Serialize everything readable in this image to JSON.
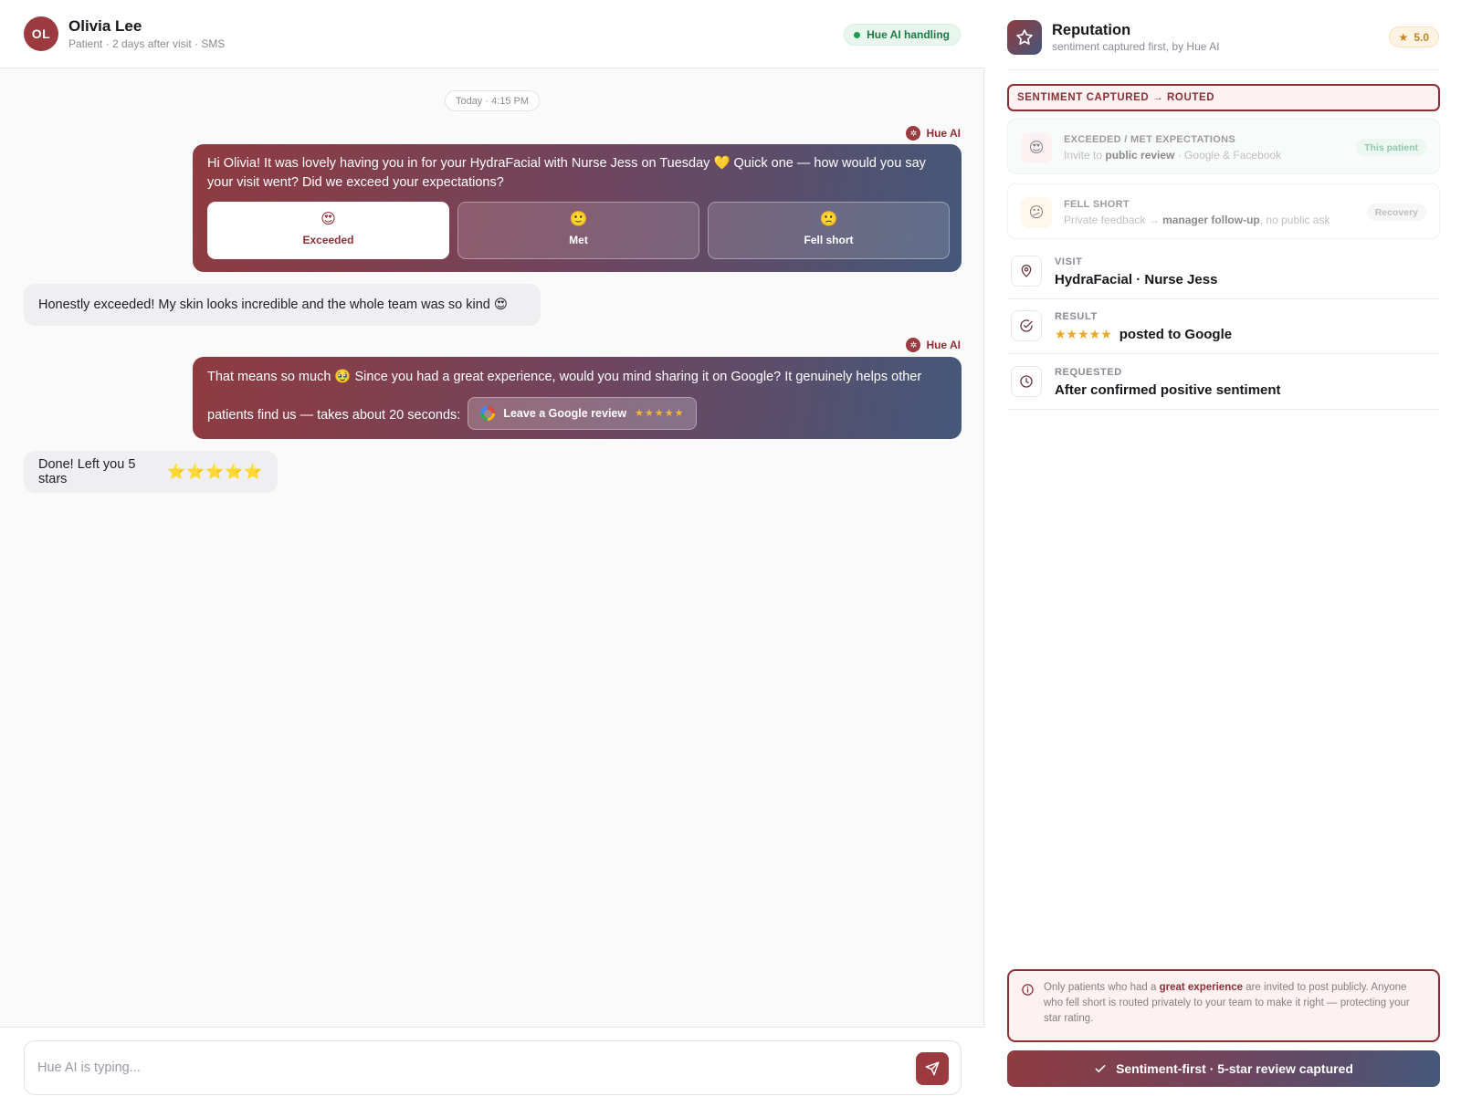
{
  "header": {
    "avatar_initials": "OL",
    "name": "Olivia Lee",
    "subtitle": "Patient · 2 days after visit · SMS",
    "status_pill": "Hue AI handling"
  },
  "chat": {
    "timestamp": "Today · 4:15 PM",
    "ai_sender": "Hue AI",
    "messages": [
      {
        "from": "ai",
        "text": "Hi Olivia! It was lovely having you in for your HydraFacial with Nurse Jess on Tuesday 💛 Quick one — how would you say your visit went? Did we exceed your expectations?",
        "choices": [
          {
            "emoji": "😍",
            "label": "Exceeded",
            "selected": true
          },
          {
            "emoji": "🙂",
            "label": "Met",
            "selected": false
          },
          {
            "emoji": "🙁",
            "label": "Fell short",
            "selected": false
          }
        ]
      },
      {
        "from": "patient",
        "text": "Honestly exceeded! My skin looks incredible and the whole team was so kind",
        "emoji": "😍"
      },
      {
        "from": "ai",
        "text": "That means so much 🥹 Since you had a great experience, would you mind sharing it on Google? It genuinely helps other patients find us — takes about 20 seconds:",
        "button_label": "Leave a Google review",
        "button_stars": "★★★★★"
      },
      {
        "from": "patient",
        "text": "Done! Left you 5 stars",
        "emoji": "⭐⭐⭐⭐⭐"
      }
    ]
  },
  "composer": {
    "placeholder": "Hue AI is typing..."
  },
  "sidebar": {
    "title": "Reputation",
    "subtitle": "sentiment captured first, by Hue AI",
    "rating": "5.0",
    "section_label": "SENTIMENT CAPTURED → ROUTED",
    "routes": [
      {
        "emoji": "😍",
        "title": "EXCEEDED / MET EXPECTATIONS",
        "desc_prefix": "Invite to ",
        "desc_bold": "public review",
        "desc_suffix": " · Google & Facebook",
        "badge": "This patient"
      },
      {
        "emoji": "😕",
        "title": "FELL SHORT",
        "desc_prefix": "Private feedback → ",
        "desc_bold": "manager follow-up",
        "desc_suffix": ", no public ask",
        "badge": "Recovery"
      }
    ],
    "info": [
      {
        "label": "VISIT",
        "value": "HydraFacial · Nurse Jess"
      },
      {
        "label": "RESULT",
        "stars": "★★★★★",
        "value": "posted to Google"
      },
      {
        "label": "REQUESTED",
        "value": "After confirmed positive sentiment"
      }
    ],
    "note": {
      "prefix": "Only patients who had a ",
      "bold": "great experience",
      "suffix": " are invited to post publicly. Anyone who fell short is routed privately to your team to make it right — protecting your star rating."
    },
    "cta": "Sentiment-first · 5-star review captured"
  },
  "colors": {
    "brand": "#9b3a3f",
    "gradient_start": "#8f3b40",
    "gradient_end": "#44587a",
    "success": "#1f9a55",
    "star": "#e8a72b"
  }
}
